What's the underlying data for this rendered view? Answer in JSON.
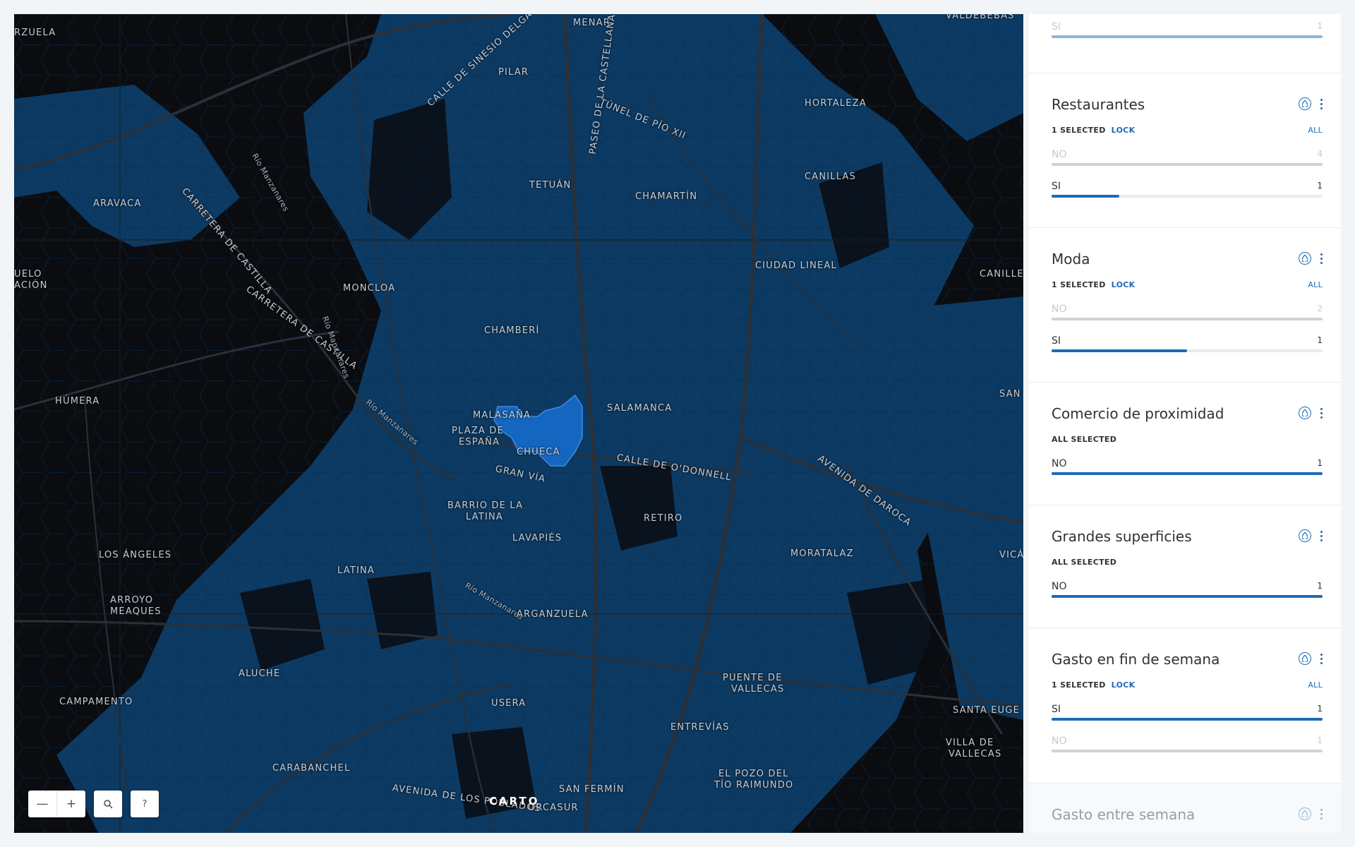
{
  "map": {
    "labels": [
      {
        "text": "RZUELA",
        "kind": "district"
      },
      {
        "text": "MENAR",
        "kind": "district"
      },
      {
        "text": "VALDEBEBAS",
        "kind": "district"
      },
      {
        "text": "PILAR",
        "kind": "district"
      },
      {
        "text": "CALLE DE SINESIO DELGADO",
        "kind": "street"
      },
      {
        "text": "TÚNEL DE PÍO XII",
        "kind": "street"
      },
      {
        "text": "HORTALEZA",
        "kind": "district"
      },
      {
        "text": "Río Manzanares",
        "kind": "river"
      },
      {
        "text": "PASEO DE LA CASTELLANA",
        "kind": "street"
      },
      {
        "text": "TETUÁN",
        "kind": "district"
      },
      {
        "text": "CHAMARTÍN",
        "kind": "district"
      },
      {
        "text": "CANILLAS",
        "kind": "district"
      },
      {
        "text": "ARAVACA",
        "kind": "district"
      },
      {
        "text": "CARRETERA DE CASTILLA",
        "kind": "street"
      },
      {
        "text": "CIUDAD LINEAL",
        "kind": "district"
      },
      {
        "text": "CANILLE",
        "kind": "district"
      },
      {
        "text": "UELO",
        "kind": "district"
      },
      {
        "text": "ACIÓN",
        "kind": "district"
      },
      {
        "text": "MONCLOA",
        "kind": "district"
      },
      {
        "text": "CARRETERA DE CASTILLA",
        "kind": "street"
      },
      {
        "text": "Río Manzanares",
        "kind": "river"
      },
      {
        "text": "CHAMBERÍ",
        "kind": "district"
      },
      {
        "text": "HÚMERA",
        "kind": "district"
      },
      {
        "text": "Río Manzanares",
        "kind": "river"
      },
      {
        "text": "MALASAÑA",
        "kind": "district"
      },
      {
        "text": "SALAMANCA",
        "kind": "district"
      },
      {
        "text": "SAN BL",
        "kind": "district"
      },
      {
        "text": "PLAZA DE",
        "kind": "district"
      },
      {
        "text": "ESPAÑA",
        "kind": "district"
      },
      {
        "text": "CHUECA",
        "kind": "district"
      },
      {
        "text": "AVENIDA DE DAROCA",
        "kind": "street"
      },
      {
        "text": "GRAN VÍA",
        "kind": "street"
      },
      {
        "text": "CALLE DE O'DONNELL",
        "kind": "street"
      },
      {
        "text": "BARRIO DE LA",
        "kind": "district"
      },
      {
        "text": "LATINA",
        "kind": "district"
      },
      {
        "text": "RETIRO",
        "kind": "district"
      },
      {
        "text": "LAVAPIÉS",
        "kind": "district"
      },
      {
        "text": "LOS ÁNGELES",
        "kind": "district"
      },
      {
        "text": "MORATALAZ",
        "kind": "district"
      },
      {
        "text": "VICÁLVA",
        "kind": "district"
      },
      {
        "text": "LATINA",
        "kind": "district"
      },
      {
        "text": "Río Manzanares",
        "kind": "river"
      },
      {
        "text": "ARROYO",
        "kind": "district"
      },
      {
        "text": "MEAQUES",
        "kind": "district"
      },
      {
        "text": "ARGANZUELA",
        "kind": "district"
      },
      {
        "text": "ALUCHE",
        "kind": "district"
      },
      {
        "text": "PUENTE DE",
        "kind": "district"
      },
      {
        "text": "VALLECAS",
        "kind": "district"
      },
      {
        "text": "CAMPAMENTO",
        "kind": "district"
      },
      {
        "text": "USERA",
        "kind": "district"
      },
      {
        "text": "SANTA EUGE",
        "kind": "district"
      },
      {
        "text": "ENTREVÍAS",
        "kind": "district"
      },
      {
        "text": "VILLA DE",
        "kind": "district"
      },
      {
        "text": "VALLECAS",
        "kind": "district"
      },
      {
        "text": "CARABANCHEL",
        "kind": "district"
      },
      {
        "text": "EL POZO DEL",
        "kind": "district"
      },
      {
        "text": "TÍO RAIMUNDO",
        "kind": "district"
      },
      {
        "text": "AVENIDA DE LOS POBLADOS",
        "kind": "street"
      },
      {
        "text": "SAN FERMÍN",
        "kind": "district"
      },
      {
        "text": "ORCASUR",
        "kind": "district"
      }
    ],
    "colors": {
      "background": "#0a0c10",
      "hexagons": "#0c3a63",
      "selected": "#1566c0",
      "roads": "#2b3038"
    },
    "attribution": "CARTO",
    "controls": {
      "zoom_out": "—",
      "zoom_in": "+",
      "search_icon": "search-icon",
      "help": "?"
    }
  },
  "widgets": [
    {
      "title": "",
      "state": "",
      "lock": "",
      "all": "",
      "categories": [
        {
          "name": "SI",
          "count": "1",
          "value": 1.0,
          "style": "dim-light"
        }
      ]
    },
    {
      "title": "Restaurantes",
      "state": "1 SELECTED",
      "lock": "LOCK",
      "all": "ALL",
      "categories": [
        {
          "name": "NO",
          "count": "4",
          "value": 1.0,
          "style": "dim"
        },
        {
          "name": "SI",
          "count": "1",
          "value": 0.25,
          "style": "active"
        }
      ]
    },
    {
      "title": "Moda",
      "state": "1 SELECTED",
      "lock": "LOCK",
      "all": "ALL",
      "categories": [
        {
          "name": "NO",
          "count": "2",
          "value": 1.0,
          "style": "dim"
        },
        {
          "name": "SI",
          "count": "1",
          "value": 0.5,
          "style": "active"
        }
      ]
    },
    {
      "title": "Comercio de proximidad",
      "state": "ALL SELECTED",
      "lock": "",
      "all": "",
      "categories": [
        {
          "name": "NO",
          "count": "1",
          "value": 1.0,
          "style": "active"
        }
      ]
    },
    {
      "title": "Grandes superficies",
      "state": "ALL SELECTED",
      "lock": "",
      "all": "",
      "categories": [
        {
          "name": "NO",
          "count": "1",
          "value": 1.0,
          "style": "active"
        }
      ]
    },
    {
      "title": "Gasto en fin de semana",
      "state": "1 SELECTED",
      "lock": "LOCK",
      "all": "ALL",
      "categories": [
        {
          "name": "SI",
          "count": "1",
          "value": 1.0,
          "style": "active"
        },
        {
          "name": "NO",
          "count": "1",
          "value": 1.0,
          "style": "dim"
        }
      ]
    },
    {
      "title": "Gasto entre semana",
      "state": "",
      "lock": "",
      "all": "",
      "categories": [],
      "faded": true
    }
  ],
  "colors": {
    "accent": "#1f6ab5",
    "muted": "#cfd3d8"
  }
}
